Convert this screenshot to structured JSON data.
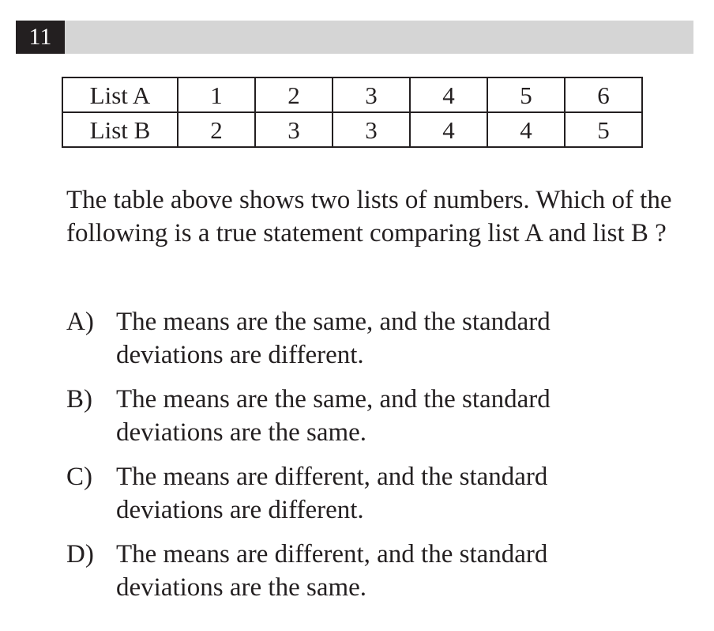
{
  "question": {
    "number": "11",
    "stem": "The table above shows two lists of numbers. Which of the following is a true statement comparing list A and list B ?"
  },
  "table": {
    "rows": [
      {
        "label": "List A",
        "values": [
          "1",
          "2",
          "3",
          "4",
          "5",
          "6"
        ]
      },
      {
        "label": "List B",
        "values": [
          "2",
          "3",
          "3",
          "4",
          "4",
          "5"
        ]
      }
    ]
  },
  "choices": [
    {
      "letter": "A)",
      "text": "The means are the same, and the standard deviations are different."
    },
    {
      "letter": "B)",
      "text": "The means are the same, and the standard deviations are the same."
    },
    {
      "letter": "C)",
      "text": "The means are different, and the standard deviations are different."
    },
    {
      "letter": "D)",
      "text": "The means are different, and the standard deviations are the same."
    }
  ]
}
